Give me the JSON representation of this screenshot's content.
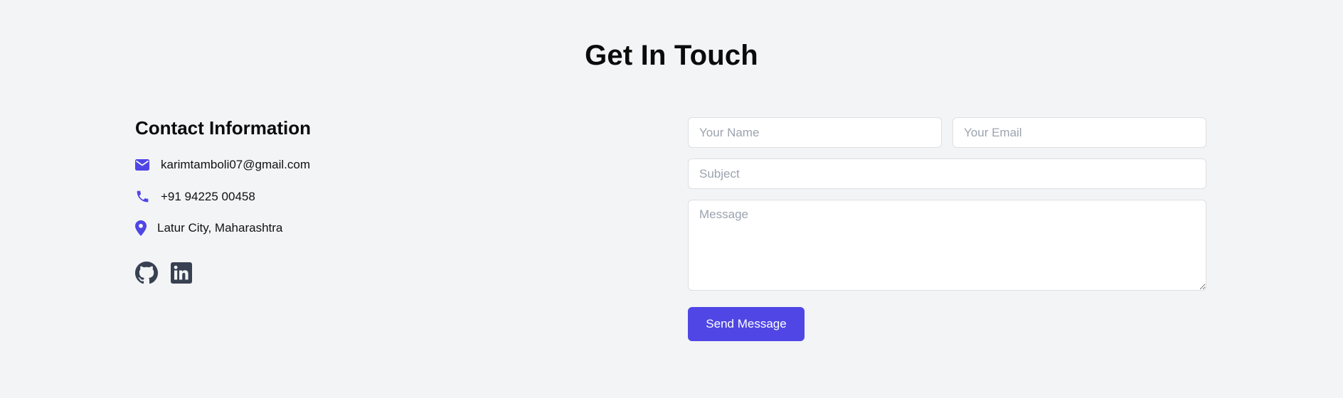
{
  "page": {
    "title": "Get In Touch"
  },
  "contact": {
    "heading": "Contact Information",
    "email": "karimtamboli07@gmail.com",
    "phone": "+91 94225 00458",
    "location": "Latur City, Maharashtra",
    "icons": {
      "email": "envelope-icon",
      "phone": "phone-icon",
      "location": "map-pin-icon"
    },
    "socials": [
      {
        "name": "GitHub",
        "icon": "github-icon"
      },
      {
        "name": "LinkedIn",
        "icon": "linkedin-icon"
      }
    ]
  },
  "form": {
    "name_placeholder": "Your Name",
    "email_placeholder": "Your Email",
    "subject_placeholder": "Subject",
    "message_placeholder": "Message",
    "submit_label": "Send Message"
  },
  "colors": {
    "background": "#f3f4f6",
    "accent": "#4f46e5",
    "icon_dark": "#374151"
  }
}
